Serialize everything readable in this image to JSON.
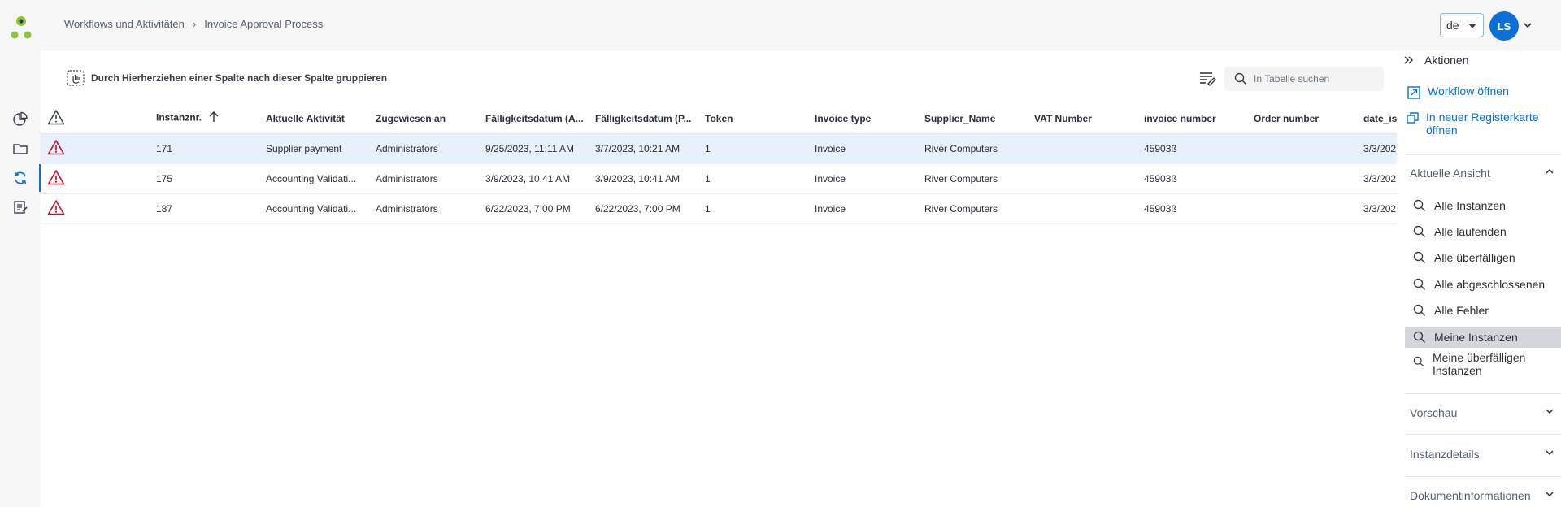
{
  "breadcrumb": {
    "root": "Workflows und Aktivitäten",
    "current": "Invoice Approval Process"
  },
  "header": {
    "language": "de",
    "user_initials": "LS"
  },
  "toolbar": {
    "group_hint": "Durch Hierherziehen einer Spalte nach dieser Spalte gruppieren",
    "search_placeholder": "In Tabelle suchen"
  },
  "table": {
    "columns": [
      "Instanznr.",
      "Aktuelle Aktivität",
      "Zugewiesen an",
      "Fälligkeitsdatum (A...",
      "Fälligkeitsdatum (P...",
      "Token",
      "Invoice type",
      "Supplier_Name",
      "VAT Number",
      "invoice number",
      "Order number",
      "date_is"
    ],
    "rows": [
      [
        "171",
        "Supplier payment",
        "Administrators",
        "9/25/2023, 11:11 AM",
        "3/7/2023, 10:21 AM",
        "1",
        "Invoice",
        "River Computers",
        "",
        "45903ß",
        "",
        "3/3/202"
      ],
      [
        "175",
        "Accounting Validati...",
        "Administrators",
        "3/9/2023, 10:41 AM",
        "3/9/2023, 10:41 AM",
        "1",
        "Invoice",
        "River Computers",
        "",
        "45903ß",
        "",
        "3/3/202"
      ],
      [
        "187",
        "Accounting Validati...",
        "Administrators",
        "6/22/2023, 7:00 PM",
        "6/22/2023, 7:00 PM",
        "1",
        "Invoice",
        "River Computers",
        "",
        "45903ß",
        "",
        "3/3/202"
      ]
    ]
  },
  "panel": {
    "title": "Aktionen",
    "actions": {
      "open_workflow": "Workflow öffnen",
      "open_new_tab": "In neuer Registerkarte öffnen"
    },
    "current_view": {
      "title": "Aktuelle Ansicht",
      "items": [
        "Alle Instanzen",
        "Alle laufenden",
        "Alle überfälligen",
        "Alle abgeschlossenen",
        "Alle Fehler",
        "Meine Instanzen",
        "Meine überfälligen Instanzen"
      ]
    },
    "sections": [
      "Vorschau",
      "Instanzdetails",
      "Dokumentinformationen"
    ]
  },
  "colors": {
    "accent": "#0a6fd6",
    "warning": "#c8102e",
    "selected_row": "#e7f1fb",
    "logo_green": "#8cc63f"
  }
}
